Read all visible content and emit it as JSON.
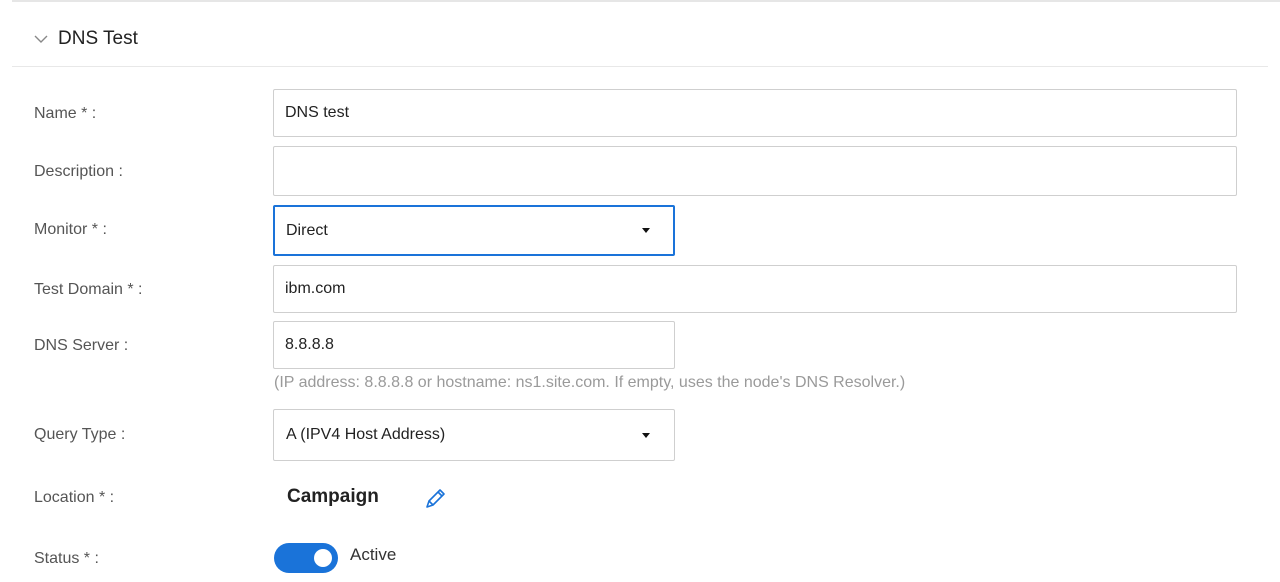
{
  "section": {
    "title": "DNS Test"
  },
  "form": {
    "name": {
      "label": "Name * :",
      "value": "DNS test"
    },
    "description": {
      "label": "Description :",
      "value": ""
    },
    "monitor": {
      "label": "Monitor * :",
      "value": "Direct"
    },
    "test_domain": {
      "label": "Test Domain * :",
      "value": "ibm.com"
    },
    "dns_server": {
      "label": "DNS Server :",
      "value": "8.8.8.8",
      "hint": "(IP address: 8.8.8.8 or hostname: ns1.site.com. If empty, uses the node's DNS Resolver.)"
    },
    "query_type": {
      "label": "Query Type :",
      "value": "A (IPV4 Host Address)"
    },
    "location": {
      "label": "Location * :",
      "value": "Campaign"
    },
    "status": {
      "label": "Status * :",
      "value": "Active",
      "enabled": true
    }
  },
  "colors": {
    "accent": "#1a73d9",
    "hint": "#9a9a9a",
    "border": "#cfcfcf"
  },
  "icons": {
    "collapse": "chevron-down-icon",
    "edit": "pencil-icon",
    "dropdown": "caret-down-icon"
  }
}
